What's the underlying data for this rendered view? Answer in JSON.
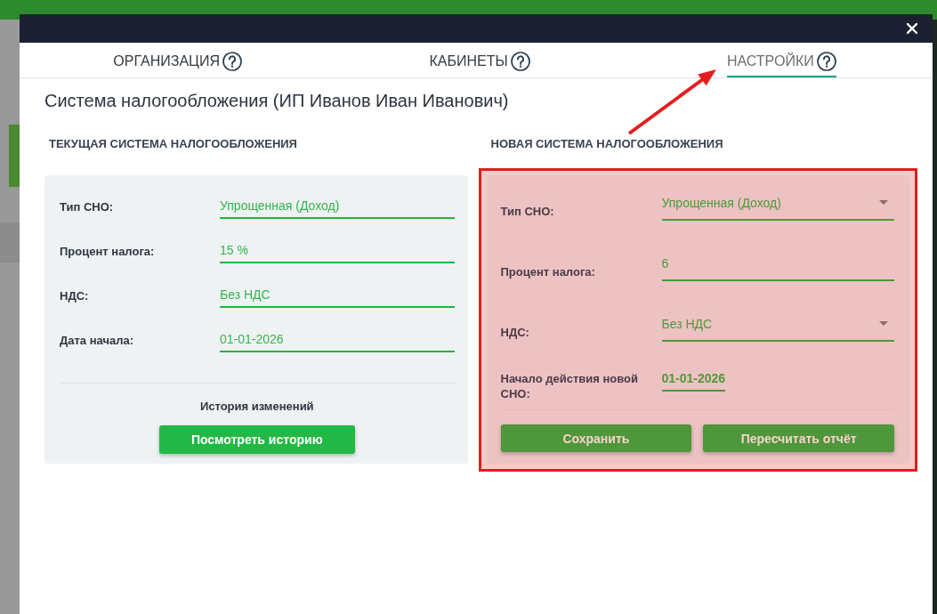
{
  "dialog": {
    "tabs": [
      {
        "label": "ОРГАНИЗАЦИЯ",
        "selected": false,
        "help": true
      },
      {
        "label": "КАБИНЕТЫ",
        "selected": false,
        "help": true
      },
      {
        "label": "НАСТРОЙКИ",
        "selected": true,
        "help": true
      }
    ],
    "title": "Система налогообложения (ИП Иванов Иван Иванович)",
    "current_system": {
      "heading": "ТЕКУЩАЯ СИСТЕМА НАЛОГООБЛОЖЕНИЯ",
      "fields": [
        {
          "label": "Тип СНО:",
          "value": "Упрощенная (Доход)"
        },
        {
          "label": "Процент налога:",
          "value": "15 %"
        },
        {
          "label": "НДС:",
          "value": "Без НДС"
        },
        {
          "label": "Дата начала:",
          "value": "01-01-2026"
        }
      ],
      "history_label": "История изменений",
      "history_button": "Посмотреть историю"
    },
    "new_system": {
      "heading": "НОВАЯ СИСТЕМА НАЛОГООБЛОЖЕНИЯ",
      "highlighted": true,
      "fields": [
        {
          "label": "Тип СНО:",
          "value": "Упрощенная (Доход)",
          "kind": "dropdown"
        },
        {
          "label": "Процент налога:",
          "value": "6",
          "kind": "input"
        },
        {
          "label": "НДС:",
          "value": "Без НДС",
          "kind": "dropdown"
        },
        {
          "label": "Начало действия новой СНО:",
          "value": "01-01-2026",
          "kind": "date"
        }
      ],
      "buttons": [
        "Сохранить",
        "Пересчитать отчёт"
      ]
    }
  },
  "annotations": [
    {
      "kind": "arrow"
    }
  ]
}
